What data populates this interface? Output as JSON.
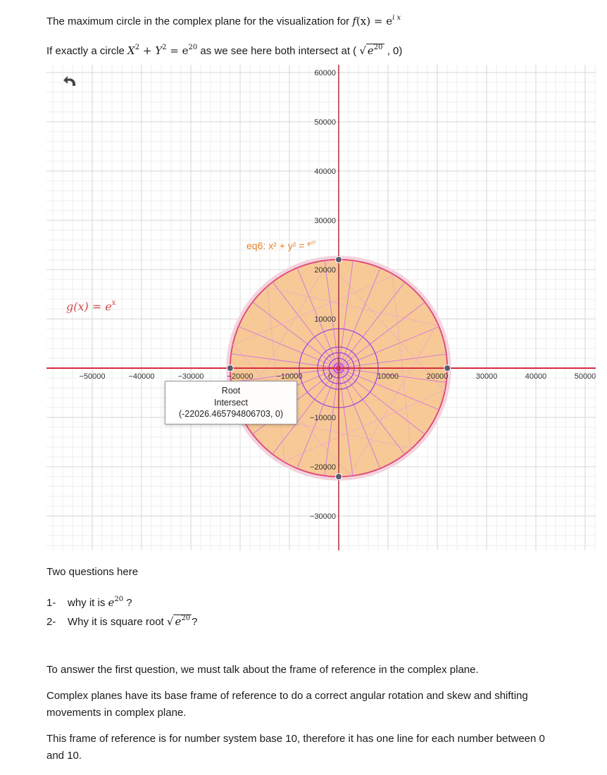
{
  "doc": {
    "line1_text": "The maximum circle in the complex plane for the visualization for ",
    "line1_math_fx": "f",
    "line1_math_eq": "(x) = e",
    "line1_math_exp": "i x",
    "line2_a": "If exactly a circle ",
    "line2_math_x": "X",
    "line2_math_plus": " + ",
    "line2_math_y": "Y",
    "line2_math_eq": " = e",
    "line2_exp_2": "2",
    "line2_exp_20": "20",
    "line2_b": " as we see here both intersect at ( ",
    "line2_root_base": "e",
    "line2_root_exp": "20",
    "line2_c": " , 0)",
    "questions_heading": "Two questions here",
    "q1_num": "1-",
    "q1_text": "why it is ",
    "q1_math_base": "e",
    "q1_math_exp": "20",
    "q1_tail": " ?",
    "q2_num": "2-",
    "q2_text": "Why it is square root ",
    "q2_math_base": "e",
    "q2_math_exp": "20",
    "q2_tail": "?",
    "answer_p1": "To answer the first question, we must talk about the frame of reference in the complex plane.",
    "answer_p2": "Complex planes have its base frame of reference to do a correct angular rotation and skew and shifting movements in complex plane.",
    "answer_p3": "This frame of reference is for number system base 10, therefore it has one line for each number between 0 and 10."
  },
  "graph": {
    "x_ticks": [
      "−50000",
      "−40000",
      "−30000",
      "−20000",
      "−10000",
      "0",
      "10000",
      "20000",
      "30000",
      "40000",
      "50000"
    ],
    "y_ticks_pos": [
      "60000",
      "50000",
      "40000",
      "30000",
      "20000",
      "10000"
    ],
    "y_ticks_neg": [
      "−10000",
      "−20000",
      "−30000"
    ],
    "eq_label_main": "eq6: x² + y² = ",
    "eq_label_exp": "e²⁰",
    "g_label_lhs": "g(x) = e",
    "g_label_exp": "x",
    "tooltip_title": "Root",
    "tooltip_sub": "Intersect",
    "tooltip_coords": "(-22026.465794806703, 0)",
    "undo_icon": "undo-icon",
    "colors": {
      "axis_red": "#d62d3e",
      "circle_fill": "#f7c996",
      "circle_stroke": "#e0457a",
      "spoke": "#cf73e0",
      "purple": "#a542e0",
      "point": "#5b5b6e",
      "eq_label": "#e4822a"
    }
  }
}
